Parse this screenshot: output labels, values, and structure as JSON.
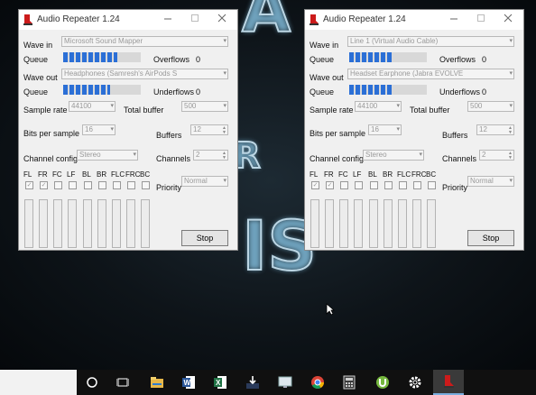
{
  "colors": {
    "meter_blue": "#2b6fd6",
    "window_bg": "#f0f0f0",
    "taskbar": "#101010",
    "app_icon_red": "#cc1b1b"
  },
  "windows": [
    {
      "title": "Audio Repeater 1.24",
      "wave_in_label": "Wave in",
      "wave_in": "Microsoft Sound Mapper",
      "queue_label": "Queue",
      "queue_in_level": 0.7,
      "overflows_label": "Overflows",
      "overflows": "0",
      "wave_out_label": "Wave out",
      "wave_out": "Headphones (Samresh's AirPods S",
      "queue_out_level": 0.6,
      "underflows_label": "Underflows",
      "underflows": "0",
      "sample_rate_label": "Sample rate",
      "sample_rate": "44100",
      "total_buffer_label": "Total buffer",
      "total_buffer": "500",
      "bits_label": "Bits per sample",
      "bits": "16",
      "buffers_label": "Buffers",
      "buffers": "12",
      "channel_config_label": "Channel config",
      "channel_config": "Stereo",
      "channels_label": "Channels",
      "channels": "2",
      "speakers": [
        "FL",
        "FR",
        "FC",
        "LF",
        "BL",
        "BR",
        "FLC",
        "FRC",
        "BC"
      ],
      "speakers_checked": [
        true,
        true,
        false,
        false,
        false,
        false,
        false,
        false,
        false
      ],
      "priority_label": "Priority",
      "priority": "Normal",
      "stop_label": "Stop"
    },
    {
      "title": "Audio Repeater 1.24",
      "wave_in_label": "Wave in",
      "wave_in": "Line 1 (Virtual Audio Cable)",
      "queue_label": "Queue",
      "queue_in_level": 0.55,
      "overflows_label": "Overflows",
      "overflows": "0",
      "wave_out_label": "Wave out",
      "wave_out": "Headset Earphone (Jabra EVOLVE",
      "queue_out_level": 0.55,
      "underflows_label": "Underflows",
      "underflows": "0",
      "sample_rate_label": "Sample rate",
      "sample_rate": "44100",
      "total_buffer_label": "Total buffer",
      "total_buffer": "500",
      "bits_label": "Bits per sample",
      "bits": "16",
      "buffers_label": "Buffers",
      "buffers": "12",
      "channel_config_label": "Channel config",
      "channel_config": "Stereo",
      "channels_label": "Channels",
      "channels": "2",
      "speakers": [
        "FL",
        "FR",
        "FC",
        "LF",
        "BL",
        "BR",
        "FLC",
        "FRC",
        "BC"
      ],
      "speakers_checked": [
        true,
        true,
        false,
        false,
        false,
        false,
        false,
        false,
        false
      ],
      "priority_label": "Priority",
      "priority": "Normal",
      "stop_label": "Stop"
    }
  ],
  "taskbar": {
    "icons": [
      "cortana-icon",
      "task-view-icon",
      "file-explorer-icon",
      "word-icon",
      "excel-icon",
      "install-icon",
      "remote-desktop-icon",
      "chrome-icon",
      "calculator-icon",
      "utorrent-icon",
      "settings-icon",
      "audio-repeater-icon"
    ]
  }
}
